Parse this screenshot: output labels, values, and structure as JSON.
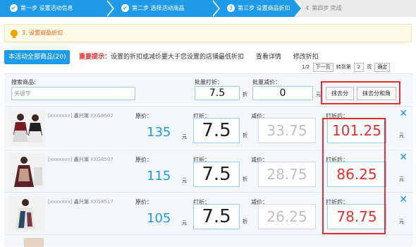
{
  "steps": [
    {
      "icon": "✔",
      "label": "第一步 设置活动信息"
    },
    {
      "icon": "✔",
      "label": "第二步 选择活动商品"
    },
    {
      "icon": "3",
      "label": "第三步 设置商品折扣"
    },
    {
      "icon": "4",
      "label": "第四步 完成"
    }
  ],
  "notice": {
    "text": "3. 设置商品折扣"
  },
  "toolbar": {
    "all_button": "本活动全部商品(20)",
    "tip_label": "重要提示：",
    "tip_text": "设置的折扣或减价要大于您设置的店铺最低折扣",
    "view_detail": "查看详情",
    "edit_discount": "修改折扣"
  },
  "pager": {
    "current": "1/2",
    "next": "下一页",
    "goto_prefix": "转到第",
    "goto_value": "2",
    "goto_suffix": "页",
    "confirm": "确定"
  },
  "filter": {
    "search_label": "搜索商品:",
    "search_placeholder": "关键字",
    "batch_discount_label": "批量打折：",
    "batch_discount_value": "7.5",
    "discount_unit": "折",
    "batch_reduce_label": "批量减价：",
    "batch_reduce_value": "0",
    "yuan_unit": "元",
    "round_fen": "抹去分",
    "round_jiao": "抹去分和角"
  },
  "labels": {
    "orig_price": "原价：",
    "discount": "打折：",
    "reduce": "减价：",
    "after": "打折后："
  },
  "products": [
    {
      "code": "[xxxxxxx]",
      "brand": "鑫兴潮",
      "sku": "XXG8602",
      "price": "135",
      "discount": "7.5",
      "reduce": "33.75",
      "after": "101.25"
    },
    {
      "code": "[xxxxxxx]",
      "brand": "鑫兴潮",
      "sku": "XXG8507",
      "price": "115",
      "discount": "7.5",
      "reduce": "28.75",
      "after": "86.25"
    },
    {
      "code": "[xxxxxxx]",
      "brand": "鑫兴潮",
      "sku": "XXG8517",
      "price": "105",
      "discount": "7.5",
      "reduce": "26.25",
      "after": "78.75"
    }
  ],
  "units": {
    "yuan": "元",
    "zhe": "折"
  },
  "close_icon": "✕",
  "colors": {
    "accent": "#1e9ae6",
    "warning": "#e23030",
    "notice_text": "#e8591a"
  }
}
